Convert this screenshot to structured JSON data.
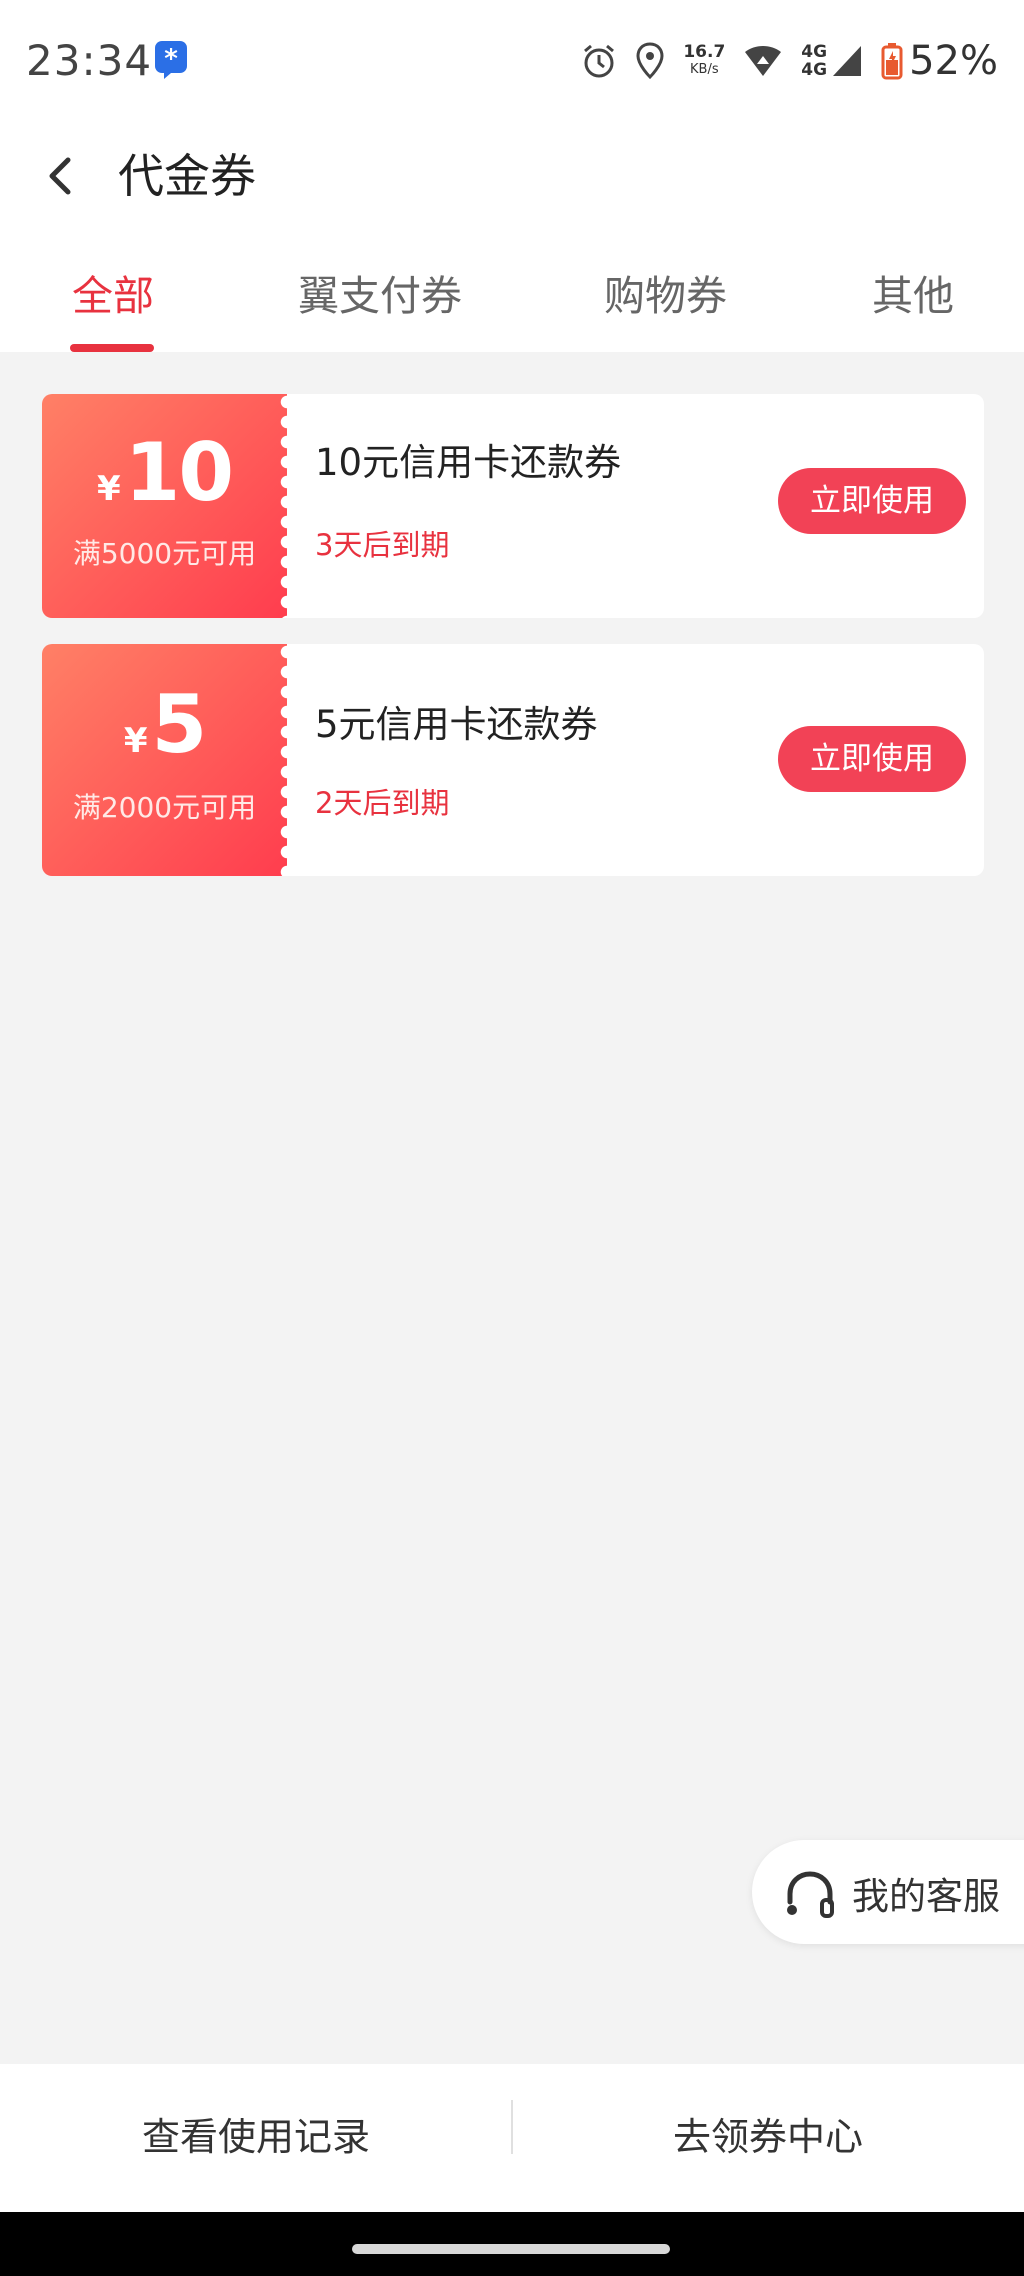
{
  "status_bar": {
    "time": "23:34",
    "speed_value": "16.7",
    "speed_unit": "KB/s",
    "network_top": "4G",
    "network_bottom": "4G",
    "battery": "52%"
  },
  "header": {
    "title": "代金券"
  },
  "tabs": [
    {
      "label": "全部",
      "active": true
    },
    {
      "label": "翼支付券",
      "active": false
    },
    {
      "label": "购物券",
      "active": false
    },
    {
      "label": "其他",
      "active": false
    }
  ],
  "coupons": [
    {
      "currency": "¥",
      "amount": "10",
      "threshold": "满5000元可用",
      "title": "10元信用卡还款券",
      "expiry": "3天后到期",
      "button": "立即使用"
    },
    {
      "currency": "¥",
      "amount": "5",
      "threshold": "满2000元可用",
      "title": "5元信用卡还款券",
      "expiry": "2天后到期",
      "button": "立即使用"
    }
  ],
  "service": {
    "label": "我的客服"
  },
  "bottom_bar": {
    "left": "查看使用记录",
    "right": "去领券中心"
  },
  "colors": {
    "accent": "#e8323f",
    "button": "#f24256",
    "background": "#f3f3f3"
  }
}
